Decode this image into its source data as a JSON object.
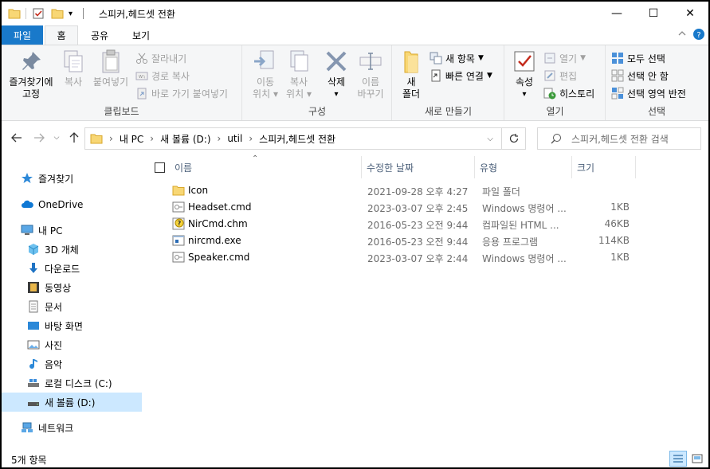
{
  "window": {
    "title": "스피커,헤드셋 전환",
    "minimize_glyph": "—",
    "maximize_glyph": "☐",
    "close_glyph": "✕"
  },
  "ribbon_tabs": {
    "file": "파일",
    "home": "홈",
    "share": "공유",
    "view": "보기"
  },
  "ribbon": {
    "clipboard": {
      "label": "클립보드",
      "pin": "즐겨찾기에 고정",
      "pin_l1": "즐겨찾기에",
      "pin_l2": "고정",
      "copy": "복사",
      "paste": "붙여넣기",
      "cut": "잘라내기",
      "copy_path": "경로 복사",
      "paste_shortcut": "바로 가기 붙여넣기"
    },
    "organize": {
      "label": "구성",
      "move_to_l1": "이동",
      "move_to_l2": "위치",
      "copy_to_l1": "복사",
      "copy_to_l2": "위치",
      "delete": "삭제",
      "rename_l1": "이름",
      "rename_l2": "바꾸기"
    },
    "new": {
      "label": "새로 만들기",
      "new_folder_l1": "새",
      "new_folder_l2": "폴더",
      "new_item": "새 항목",
      "easy_access": "빠른 연결"
    },
    "open": {
      "label": "열기",
      "properties": "속성",
      "open": "열기",
      "edit": "편집",
      "history": "히스토리"
    },
    "select": {
      "label": "선택",
      "select_all": "모두 선택",
      "select_none": "선택 안 함",
      "invert": "선택 영역 반전"
    }
  },
  "address": {
    "path": [
      "내 PC",
      "새 볼륨 (D:)",
      "util",
      "스피커,헤드셋 전환"
    ],
    "search_placeholder": "스피커,헤드셋 전환 검색"
  },
  "nav_pane": {
    "items": [
      {
        "label": "즐겨찾기",
        "icon": "star-icon"
      },
      {
        "label": "OneDrive",
        "icon": "cloud-icon"
      },
      {
        "label": "내 PC",
        "icon": "pc-icon"
      },
      {
        "label": "3D 개체",
        "icon": "cube-icon"
      },
      {
        "label": "다운로드",
        "icon": "download-icon"
      },
      {
        "label": "동영상",
        "icon": "video-icon"
      },
      {
        "label": "문서",
        "icon": "document-icon"
      },
      {
        "label": "바탕 화면",
        "icon": "desktop-icon"
      },
      {
        "label": "사진",
        "icon": "picture-icon"
      },
      {
        "label": "음악",
        "icon": "music-icon"
      },
      {
        "label": "로컬 디스크 (C:)",
        "icon": "drive-icon"
      },
      {
        "label": "새 볼륨 (D:)",
        "icon": "drive-icon",
        "selected": true
      },
      {
        "label": "네트워크",
        "icon": "network-icon"
      }
    ]
  },
  "file_list": {
    "columns": {
      "name": "이름",
      "date": "수정한 날짜",
      "type": "유형",
      "size": "크기"
    },
    "files": [
      {
        "name": "Icon",
        "date": "2021-09-28 오후 4:27",
        "type": "파일 폴더",
        "size": "",
        "icon": "folder-icon"
      },
      {
        "name": "Headset.cmd",
        "date": "2023-03-07 오후 2:45",
        "type": "Windows 명령어 ...",
        "size": "1KB",
        "icon": "cmd-file-icon"
      },
      {
        "name": "NirCmd.chm",
        "date": "2016-05-23 오전 9:44",
        "type": "컴파일된 HTML ...",
        "size": "46KB",
        "icon": "help-file-icon"
      },
      {
        "name": "nircmd.exe",
        "date": "2016-05-23 오전 9:44",
        "type": "응용 프로그램",
        "size": "114KB",
        "icon": "exe-file-icon"
      },
      {
        "name": "Speaker.cmd",
        "date": "2023-03-07 오후 2:44",
        "type": "Windows 명령어 ...",
        "size": "1KB",
        "icon": "cmd-file-icon"
      }
    ]
  },
  "status": {
    "count": "5개 항목"
  },
  "colors": {
    "file_tab": "#1979ca",
    "selection": "#cce8ff",
    "folder": "#f8d775"
  }
}
